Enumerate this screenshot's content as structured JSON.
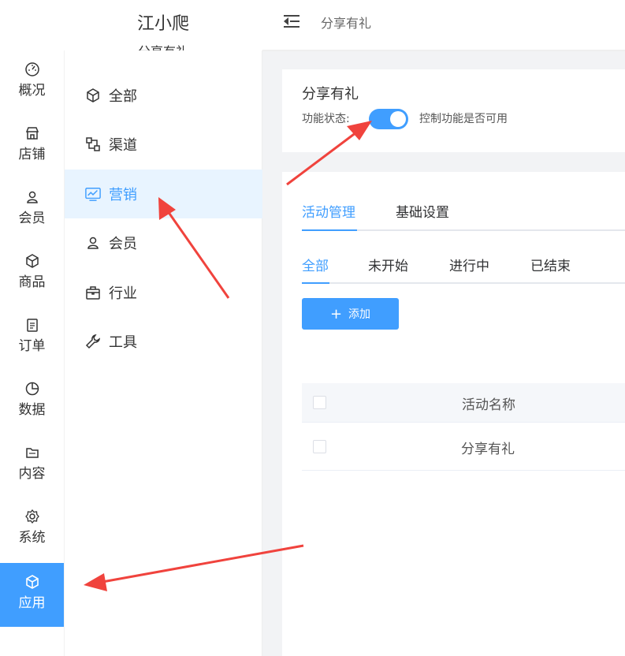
{
  "brand": {
    "title": "江小爬",
    "subtitle": "分享有礼"
  },
  "topbar": {
    "menu_icon": "menu-fold-icon",
    "breadcrumb": "分享有礼"
  },
  "nav_primary": {
    "items": [
      {
        "label": "概况",
        "icon": "dashboard-icon"
      },
      {
        "label": "店铺",
        "icon": "store-icon"
      },
      {
        "label": "会员",
        "icon": "user-icon"
      },
      {
        "label": "商品",
        "icon": "cube-icon"
      },
      {
        "label": "订单",
        "icon": "clipboard-icon"
      },
      {
        "label": "数据",
        "icon": "pie-chart-icon"
      },
      {
        "label": "内容",
        "icon": "folder-icon"
      },
      {
        "label": "系统",
        "icon": "gear-icon"
      },
      {
        "label": "应用",
        "icon": "cube-icon",
        "active": true
      }
    ]
  },
  "nav_secondary": {
    "items": [
      {
        "label": "全部",
        "icon": "cube-icon"
      },
      {
        "label": "渠道",
        "icon": "channels-icon"
      },
      {
        "label": "营销",
        "icon": "marketing-chart-icon",
        "active": true
      },
      {
        "label": "会员",
        "icon": "user-icon"
      },
      {
        "label": "行业",
        "icon": "briefcase-icon"
      },
      {
        "label": "工具",
        "icon": "wrench-icon"
      }
    ]
  },
  "feature": {
    "title": "分享有礼",
    "status_label": "功能状态:",
    "status_on": true,
    "status_desc": "控制功能是否可用"
  },
  "main_tabs": [
    {
      "label": "活动管理",
      "active": true
    },
    {
      "label": "基础设置",
      "active": false
    }
  ],
  "filter_tabs": [
    {
      "label": "全部",
      "active": true
    },
    {
      "label": "未开始",
      "active": false
    },
    {
      "label": "进行中",
      "active": false
    },
    {
      "label": "已结束",
      "active": false
    }
  ],
  "add_button": {
    "label": "添加"
  },
  "table": {
    "headers": [
      "活动名称"
    ],
    "rows": [
      [
        "分享有礼"
      ]
    ]
  },
  "colors": {
    "accent": "#409eff",
    "arrow": "#f0433d",
    "active_bg": "#e8f4ff"
  }
}
